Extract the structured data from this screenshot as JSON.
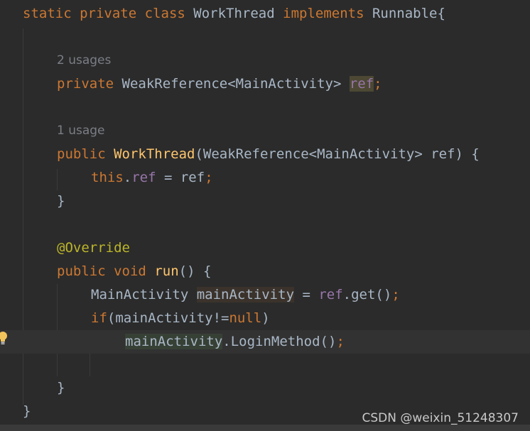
{
  "code": {
    "line1": [
      "static",
      "private",
      "class",
      "WorkThread",
      "implements",
      "Runnable{"
    ],
    "usage_ref": "2 usages",
    "line2": [
      "private",
      "WeakReference<MainActivity>",
      "ref",
      ";"
    ],
    "usage_ctor": "1 usage",
    "line3": [
      "public",
      "WorkThread",
      "(WeakReference<MainActivity> ref) {"
    ],
    "line4": [
      "this",
      ".",
      "ref",
      " = ref",
      ";"
    ],
    "line5": "}",
    "line6": "@Override",
    "line7": [
      "public",
      "void",
      "run",
      "() {"
    ],
    "line8": [
      "MainActivity",
      "mainActivity",
      " = ",
      "ref",
      ".get()",
      ";"
    ],
    "line9": [
      "if",
      "(mainActivity!=",
      "null",
      ")"
    ],
    "line10": [
      "mainActivity",
      ".LoginMethod()",
      ";"
    ],
    "line11": "}",
    "line12": "}"
  },
  "watermark": "CSDN @weixin_51248307",
  "colors": {
    "background": "#2b2b2b",
    "keyword": "#cc7832",
    "function": "#ffc66d",
    "field": "#9876aa",
    "annotation": "#bbb529",
    "text": "#a9b7c6"
  },
  "icons": {
    "gutter": "lightbulb-icon"
  }
}
